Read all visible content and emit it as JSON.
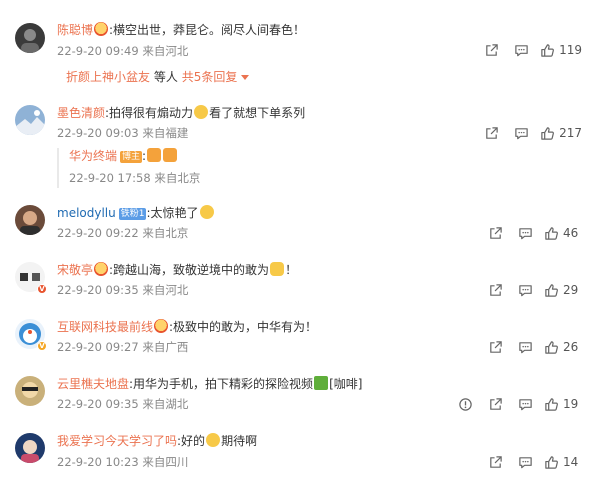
{
  "comments": [
    {
      "user": "陈聪博",
      "badge_icon": "fan-badge-icon",
      "text": ":横空出世，莽昆仑。阅尽人间春色！",
      "meta": "22-9-20 09:49 来自河北",
      "likes": "119",
      "replies_link": "折颜上神小盆友",
      "replies_middle": "等人",
      "replies_count": "共5条回复"
    },
    {
      "user": "墨色清颜",
      "text_a": ":拍得很有煽动力",
      "text_b": "看了就想下单系列",
      "meta": "22-9-20 09:03 来自福建",
      "likes": "217",
      "reply_user": "华为终端",
      "reply_tag": "博主",
      "reply_text": ":",
      "reply_meta": "22-9-20 17:58 来自北京"
    },
    {
      "user": "melodyllu",
      "tag": "铁粉1",
      "text": ":太惊艳了",
      "meta": "22-9-20 09:22 来自北京",
      "likes": "46"
    },
    {
      "user": "宋敬亭",
      "text_a": ":跨越山海，致敬逆境中的敢为",
      "text_b": "！",
      "meta": "22-9-20 09:35 来自河北",
      "likes": "29"
    },
    {
      "user": "互联网科技最前线",
      "text": ":极致中的敢为，中华有为！",
      "meta": "22-9-20 09:27 来自广西",
      "likes": "26"
    },
    {
      "user": "云里樵夫地盘",
      "text_a": ":用华为手机，拍下精彩的探险视频",
      "text_b": "[咖啡]",
      "meta": "22-9-20 09:35 来自湖北",
      "likes": "19"
    },
    {
      "user": "我爱学习今天学习了吗",
      "text_a": ":好的",
      "text_b": "期待啊",
      "meta": "22-9-20 10:23 来自四川",
      "likes": "14"
    }
  ]
}
